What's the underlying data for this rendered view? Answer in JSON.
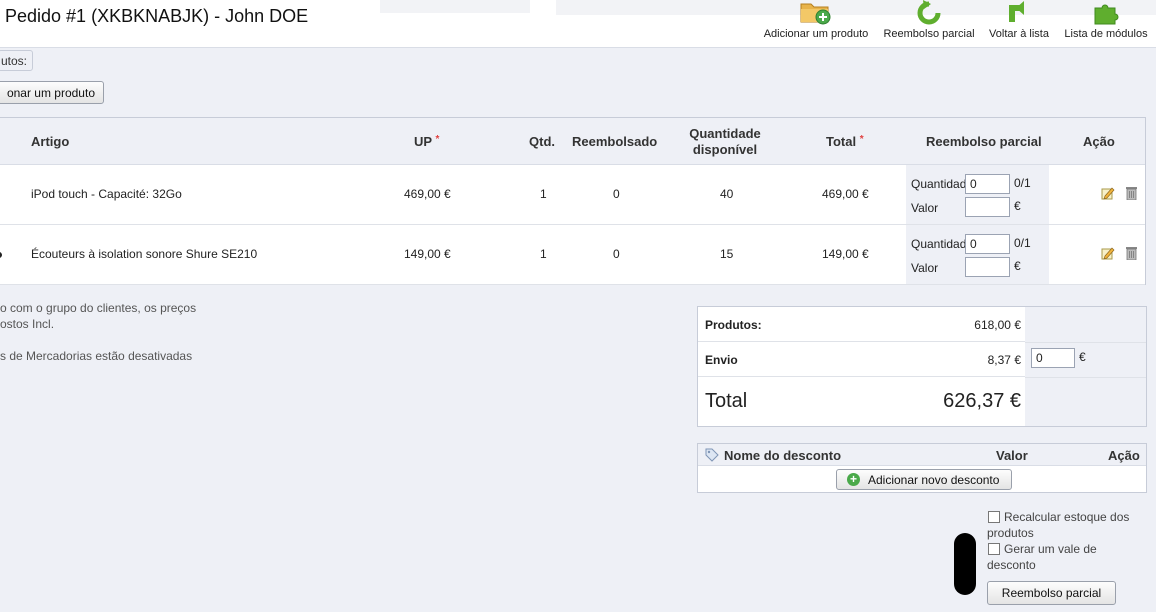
{
  "header": {
    "title": "Pedido #1 (XKBKNABJK) - John DOE",
    "toolbar": [
      {
        "label": "Adicionar um produto",
        "icon": "folder-add-icon"
      },
      {
        "label": "Reembolso parcial",
        "icon": "refresh-arrow-icon"
      },
      {
        "label": "Voltar à lista",
        "icon": "back-arrow-icon"
      },
      {
        "label": "Lista de módulos",
        "icon": "puzzle-icon"
      }
    ]
  },
  "products_section": {
    "legend": "utos:",
    "add_button": "onar um produto"
  },
  "table": {
    "headers": {
      "article": "Artigo",
      "unit_price": "UP",
      "qty": "Qtd.",
      "refunded": "Reembolsado",
      "available_1": "Quantidade",
      "available_2": "disponível",
      "total": "Total",
      "partial": "Reembolso parcial",
      "action": "Ação"
    },
    "required_mark": "*",
    "rows": [
      {
        "article": "iPod touch - Capacité: 32Go",
        "unit_price": "469,00 €",
        "qty": "1",
        "refunded": "0",
        "available": "40",
        "total": "469,00 €",
        "qty_label": "Quantidade",
        "qty_value": "0",
        "qty_max": "0/1",
        "value_label": "Valor",
        "value_value": "",
        "currency": "€"
      },
      {
        "article": "Écouteurs à isolation sonore Shure SE210",
        "unit_price": "149,00 €",
        "qty": "1",
        "refunded": "0",
        "available": "15",
        "total": "149,00 €",
        "qty_label": "Quantidade",
        "qty_value": "0",
        "qty_max": "0/1",
        "value_label": "Valor",
        "value_value": "",
        "currency": "€"
      }
    ]
  },
  "notes": {
    "line1": "o com o grupo do clientes, os preços",
    "line2": "ostos Incl.",
    "line3": "s de Mercadorias estão desativadas"
  },
  "totals": {
    "products_label": "Produtos:",
    "products_value": "618,00 €",
    "shipping_label": "Envio",
    "shipping_value": "8,37 €",
    "shipping_refund": "0",
    "shipping_currency": "€",
    "total_label": "Total",
    "total_value": "626,37 €"
  },
  "discounts": {
    "name_header": "Nome do desconto",
    "value_header": "Valor",
    "action_header": "Ação",
    "add_button": "Adicionar novo desconto"
  },
  "options": {
    "restock_1": "Recalcular estoque dos",
    "restock_2": "produtos",
    "voucher_1": "Gerar um vale de",
    "voucher_2": "desconto",
    "submit": "Reembolso parcial"
  }
}
